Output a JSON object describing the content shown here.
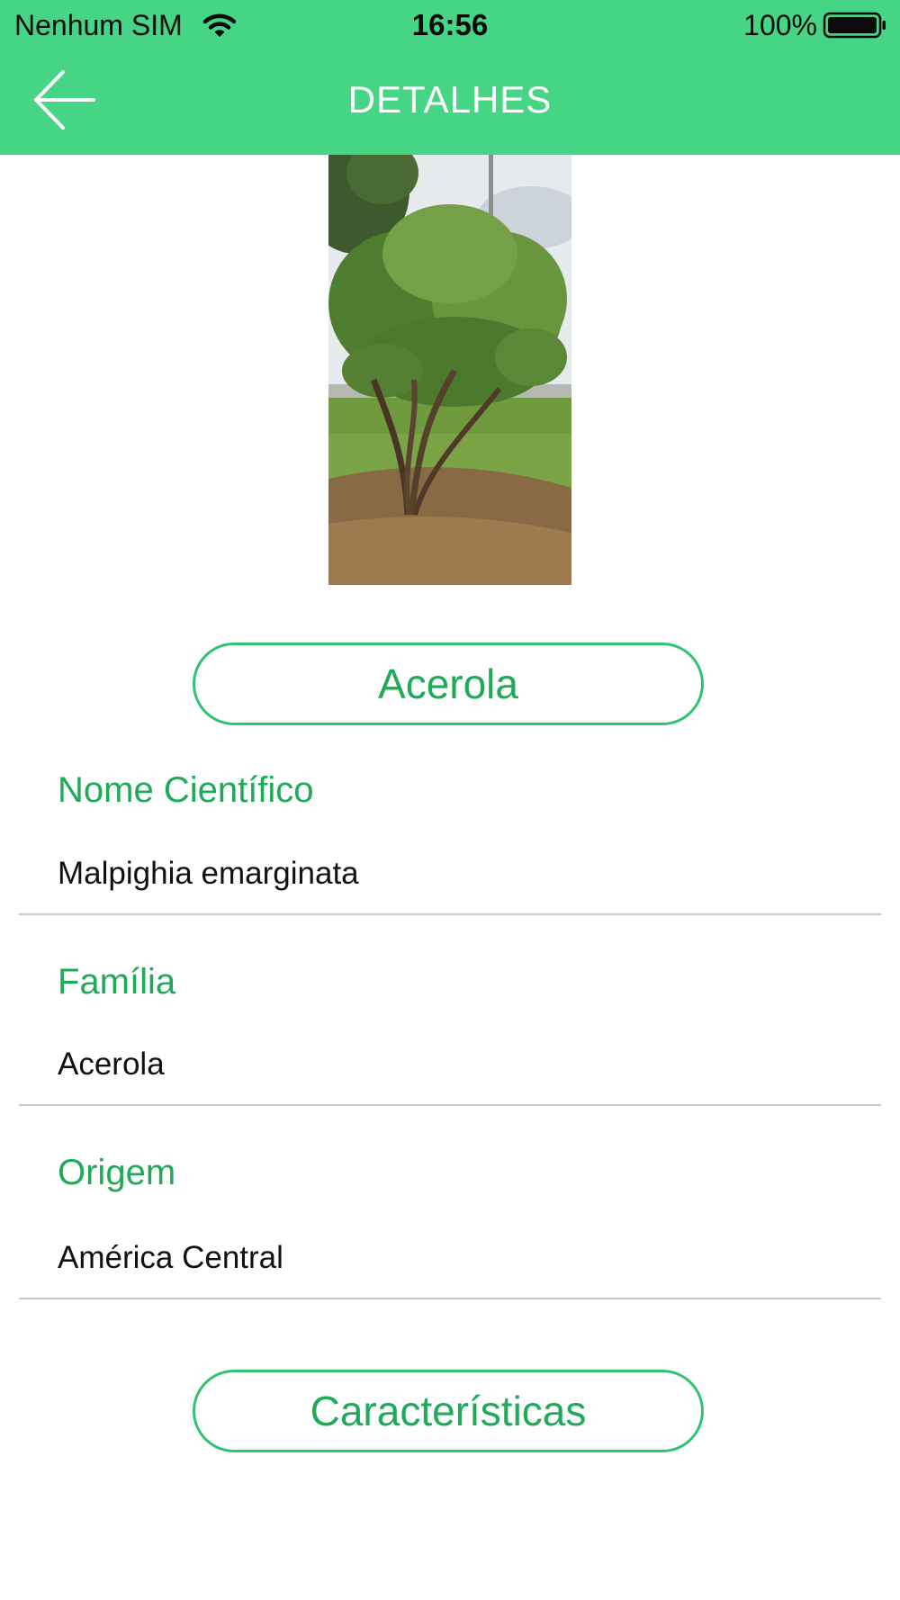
{
  "status_bar": {
    "carrier": "Nenhum SIM",
    "time": "16:56",
    "battery": "100%",
    "battery_level": 1.0
  },
  "header": {
    "title": "DETALHES",
    "back_icon": "back-arrow-icon",
    "background_color": "#46d585"
  },
  "plant": {
    "name_button": "Acerola",
    "fields": [
      {
        "label": "Nome Científico",
        "value": "Malpighia emarginata"
      },
      {
        "label": "Família",
        "value": "Acerola"
      },
      {
        "label": "Origem",
        "value": "América Central"
      }
    ],
    "characteristics_button": "Características"
  },
  "colors": {
    "accent": "#1faa58",
    "pill_border": "#2ec36f",
    "divider": "#c9c9c9"
  }
}
